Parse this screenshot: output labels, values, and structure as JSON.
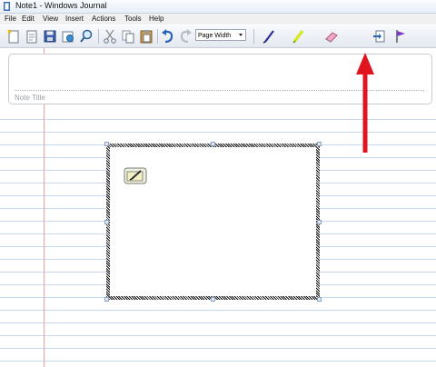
{
  "window": {
    "title": "Note1 - Windows Journal"
  },
  "menu": [
    "File",
    "Edit",
    "View",
    "Insert",
    "Actions",
    "Tools",
    "Help"
  ],
  "toolbar": {
    "buttons": [
      "new-note-icon",
      "open-icon",
      "save-icon",
      "email-icon",
      "find-icon",
      "cut-icon",
      "copy-icon",
      "paste-icon",
      "undo-icon",
      "redo-icon"
    ],
    "zoom_value": "Page Width",
    "tools": [
      "pen-icon",
      "highlighter-icon",
      "eraser-icon",
      "lasso-select-icon",
      "insert-space-icon",
      "flag-icon"
    ],
    "active_tool": "lasso-select-icon"
  },
  "note": {
    "title_placeholder": "Note Title"
  },
  "colors": {
    "annotation_arrow": "#e0141e",
    "margin_line": "#e7a3a3",
    "rule_line": "#c5d8ef"
  }
}
